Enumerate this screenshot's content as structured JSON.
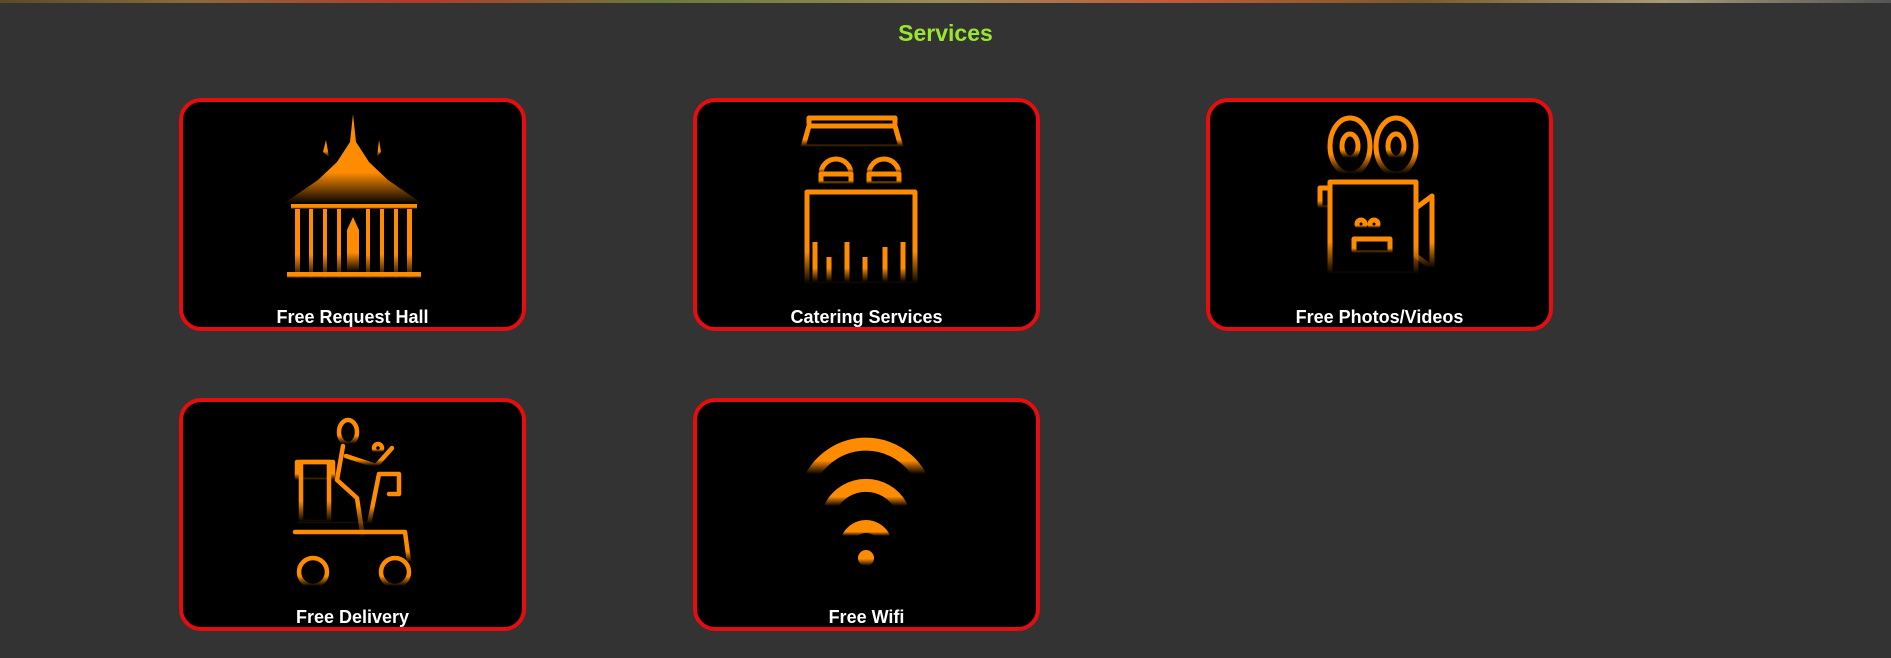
{
  "section": {
    "title": "Services"
  },
  "colors": {
    "background": "#333333",
    "title": "#9ae62f",
    "card_border": "#e50d0d",
    "card_fill": "#000000",
    "icon": "#ff8c00",
    "label": "#ffffff"
  },
  "services": [
    {
      "label": "Free Request Hall",
      "icon": "pavilion-icon"
    },
    {
      "label": "Catering Services",
      "icon": "catering-icon"
    },
    {
      "label": "Free Photos/Videos",
      "icon": "video-camera-icon"
    },
    {
      "label": "Free Delivery",
      "icon": "delivery-scooter-icon"
    },
    {
      "label": "Free Wifi",
      "icon": "wifi-icon"
    }
  ]
}
